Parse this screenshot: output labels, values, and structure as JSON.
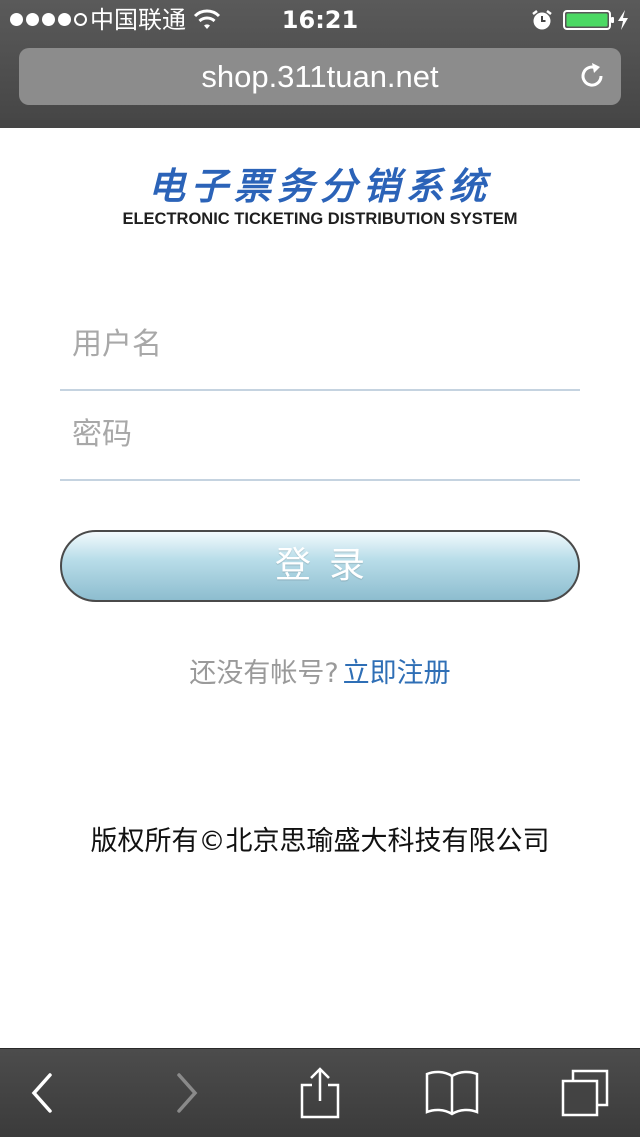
{
  "status_bar": {
    "carrier": "中国联通",
    "time": "16:21",
    "icons": [
      "signal-icon",
      "wifi-icon",
      "alarm-icon",
      "battery-icon",
      "charging-icon"
    ]
  },
  "browser": {
    "url": "shop.311tuan.net",
    "reload_icon": "reload-icon"
  },
  "logo": {
    "title_cn": "电子票务分销系统",
    "title_en": "ELECTRONIC TICKETING DISTRIBUTION SYSTEM"
  },
  "form": {
    "username_placeholder": "用户名",
    "password_placeholder": "密码",
    "login_label": "登录"
  },
  "register": {
    "question": "还没有帐号?",
    "link_label": "立即注册"
  },
  "footer": {
    "copyright": "版权所有©北京思瑜盛大科技有限公司"
  },
  "toolbar": {
    "icons": [
      "back-icon",
      "forward-icon",
      "share-icon",
      "bookmarks-icon",
      "tabs-icon"
    ]
  },
  "colors": {
    "logo_blue": "#2b63b8",
    "link_blue": "#2f6fb6",
    "button_gradient_top": "#f2fafd",
    "button_gradient_bottom": "#8dbdcf",
    "chrome_gray": "#4c4c4c"
  }
}
